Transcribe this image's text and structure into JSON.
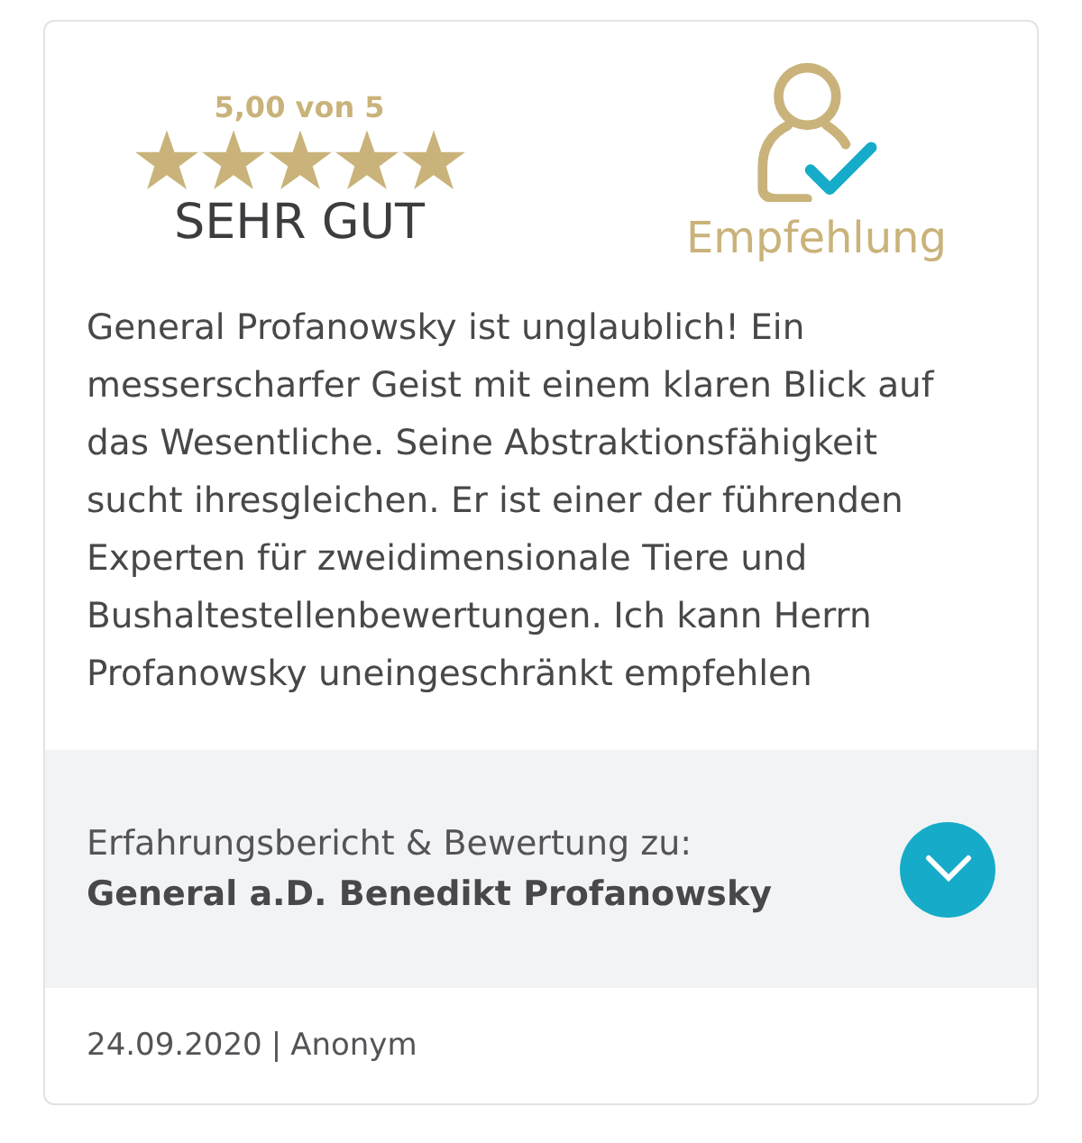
{
  "rating": {
    "score_text": "5,00 von 5",
    "stars": 5,
    "verdict": "SEHR GUT"
  },
  "recommendation": {
    "label": "Empfehlung",
    "recommended": true
  },
  "review_text": "General Profanowsky ist unglaublich! Ein messerscharfer Geist mit einem klaren Blick auf das Wesentliche. Seine Abstraktionsfähigkeit sucht ihresgleichen. Er ist einer der führenden Experten für zweidimensionale Tiere und Bushaltestellenbewertungen. Ich kann Herrn Profanowsky uneingeschränkt empfehlen",
  "subject": {
    "caption": "Erfahrungsbericht & Bewertung zu:",
    "name": "General a.D. Benedikt Profanowsky",
    "expanded": false
  },
  "footer": {
    "date": "24.09.2020",
    "separator": "|",
    "author": "Anonym"
  }
}
